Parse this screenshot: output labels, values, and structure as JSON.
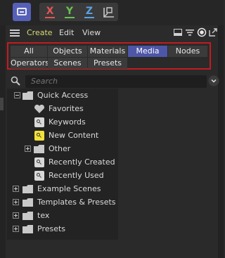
{
  "toolbar": {
    "axes": {
      "x": "X",
      "y": "Y",
      "z": "Z"
    },
    "icons": [
      "asset-browser-icon",
      "coordinate-system-icon"
    ]
  },
  "menu": {
    "items": [
      "Create",
      "Edit",
      "View"
    ],
    "right_icons": [
      "panel-icon",
      "filter-icon",
      "record-icon",
      "undock-icon"
    ]
  },
  "tabs": {
    "row1": [
      "All",
      "Objects",
      "Materials",
      "Media",
      "Nodes"
    ],
    "row2": [
      "Operators",
      "Scenes",
      "Presets"
    ],
    "active": "Media"
  },
  "search": {
    "placeholder": "Search"
  },
  "tree": {
    "quick_access": "Quick Access",
    "favorites": "Favorites",
    "keywords": "Keywords",
    "new_content": "New Content",
    "other": "Other",
    "recently_created": "Recently Created",
    "recently_used": "Recently Used",
    "example_scenes": "Example Scenes",
    "templates_presets": "Templates & Presets",
    "tex": "tex",
    "presets": "Presets"
  },
  "colors": {
    "accent": "#4e56a7",
    "highlight_border": "#c41b20",
    "create_menu": "#d9d97a",
    "new_content_icon": "#f2e13a"
  }
}
